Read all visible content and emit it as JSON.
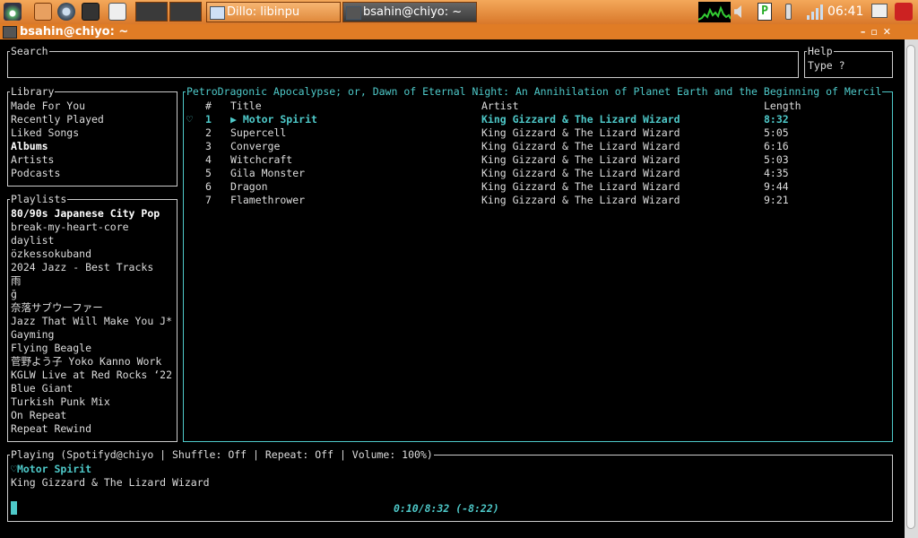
{
  "taskbar": {
    "tasks": [
      {
        "label": "Dillo: libinpu",
        "active": false
      },
      {
        "label": "bsahin@chiyo: ~",
        "active": true
      }
    ],
    "clock": "06:41"
  },
  "window": {
    "title": "bsahin@chiyo: ~"
  },
  "search": {
    "title": "Search",
    "value": ""
  },
  "help": {
    "title": "Help",
    "text": "Type ?"
  },
  "library": {
    "title": "Library",
    "items": [
      "Made For You",
      "Recently Played",
      "Liked Songs",
      "Albums",
      "Artists",
      "Podcasts"
    ],
    "selected": 3
  },
  "playlists": {
    "title": "Playlists",
    "items": [
      "80/90s Japanese City Pop",
      "break-my-heart-core",
      "daylist",
      "özkessokuband",
      "2024 Jazz - Best Tracks",
      "雨",
      "ğ",
      "奈落サブウーファー",
      "Jazz That Will Make You J*",
      "Gayming",
      "Flying Beagle",
      "菅野よう子 Yoko Kanno Work",
      "KGLW Live at Red Rocks ‘22",
      "Blue Giant",
      "Turkish Punk Mix",
      "On Repeat",
      "Repeat Rewind"
    ],
    "selected": 0
  },
  "tracklist": {
    "title": "PetroDragonic Apocalypse; or, Dawn of Eternal Night: An Annihilation of Planet Earth and the Beginning of Mercil",
    "headers": {
      "num": "#",
      "title": "Title",
      "artist": "Artist",
      "length": "Length"
    },
    "rows": [
      {
        "num": "1",
        "title": "▶ Motor Spirit",
        "artist": "King Gizzard & The Lizard Wizard",
        "length": "8:32",
        "liked": true,
        "playing": true
      },
      {
        "num": "2",
        "title": "Supercell",
        "artist": "King Gizzard & The Lizard Wizard",
        "length": "5:05"
      },
      {
        "num": "3",
        "title": "Converge",
        "artist": "King Gizzard & The Lizard Wizard",
        "length": "6:16"
      },
      {
        "num": "4",
        "title": "Witchcraft",
        "artist": "King Gizzard & The Lizard Wizard",
        "length": "5:03"
      },
      {
        "num": "5",
        "title": "Gila Monster",
        "artist": "King Gizzard & The Lizard Wizard",
        "length": "4:35"
      },
      {
        "num": "6",
        "title": "Dragon",
        "artist": "King Gizzard & The Lizard Wizard",
        "length": "9:44"
      },
      {
        "num": "7",
        "title": "Flamethrower",
        "artist": "King Gizzard & The Lizard Wizard",
        "length": "9:21"
      }
    ]
  },
  "playing": {
    "title": "Playing (Spotifyd@chiyo | Shuffle: Off | Repeat: Off   | Volume: 100%)",
    "heart": "♡",
    "track": "Motor Spirit",
    "artist": "King Gizzard & The Lizard Wizard",
    "progress": "0:10/8:32 (-8:22)",
    "progress_fraction": 0.0195
  },
  "colors": {
    "accent": "#4ec9c9",
    "taskbar": "#e07c25"
  }
}
